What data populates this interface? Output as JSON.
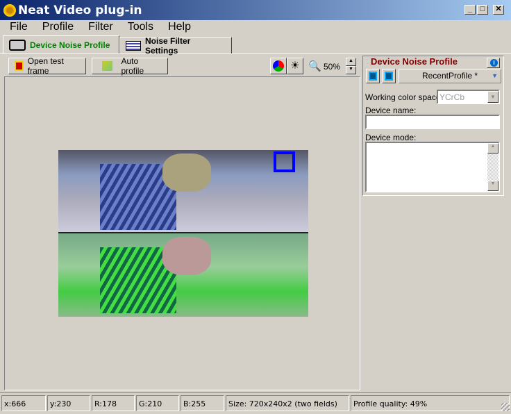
{
  "window": {
    "title": "Neat Video plug-in"
  },
  "menu": [
    "File",
    "Profile",
    "Filter",
    "Tools",
    "Help"
  ],
  "tabs": [
    {
      "label": "Device Noise Profile",
      "active": true
    },
    {
      "label": "Noise Filter Settings",
      "active": false
    }
  ],
  "toolbar": {
    "open_label": "Open test frame",
    "auto_label": "Auto profile",
    "zoom": "50%"
  },
  "panel": {
    "title": "Device Noise Profile",
    "profile": "RecentProfile *",
    "color_space_label": "Working color space:",
    "color_space": "YCrCb",
    "device_name_label": "Device name:",
    "device_name": "",
    "device_mode_label": "Device mode:",
    "device_mode": ""
  },
  "status": [
    "x:666",
    "y:230",
    "R:178",
    "G:210",
    "B:255",
    "Size: 720x240x2 (two fields)",
    "Profile quality: 49%"
  ],
  "colors": {
    "title_green": "#008000",
    "panel_title": "#800000",
    "selection": "#0000ff"
  }
}
